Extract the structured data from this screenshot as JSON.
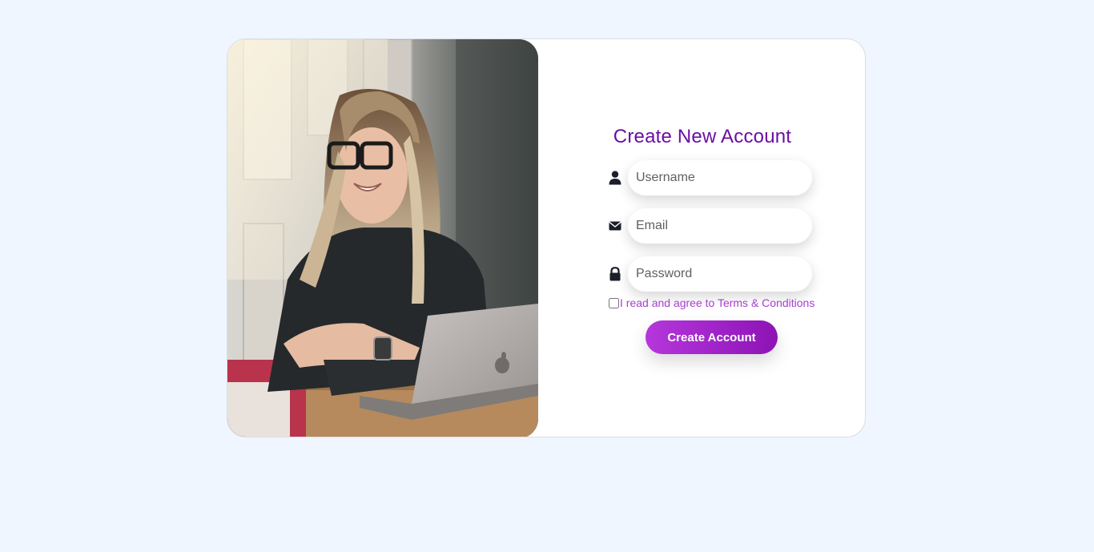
{
  "form": {
    "title": "Create New Account",
    "username_placeholder": "Username",
    "email_placeholder": "Email",
    "password_placeholder": "Password",
    "terms_label": "I read and agree to Terms & Conditions",
    "submit_label": "Create Account",
    "icons": {
      "username": "user-icon",
      "email": "envelope-icon",
      "password": "lock-icon"
    }
  },
  "colors": {
    "page_background": "#eff6ff",
    "title": "#6b0ea4",
    "terms_text": "#a83fd0",
    "button_gradient_start": "#b537dc",
    "button_gradient_end": "#8d13b5"
  }
}
